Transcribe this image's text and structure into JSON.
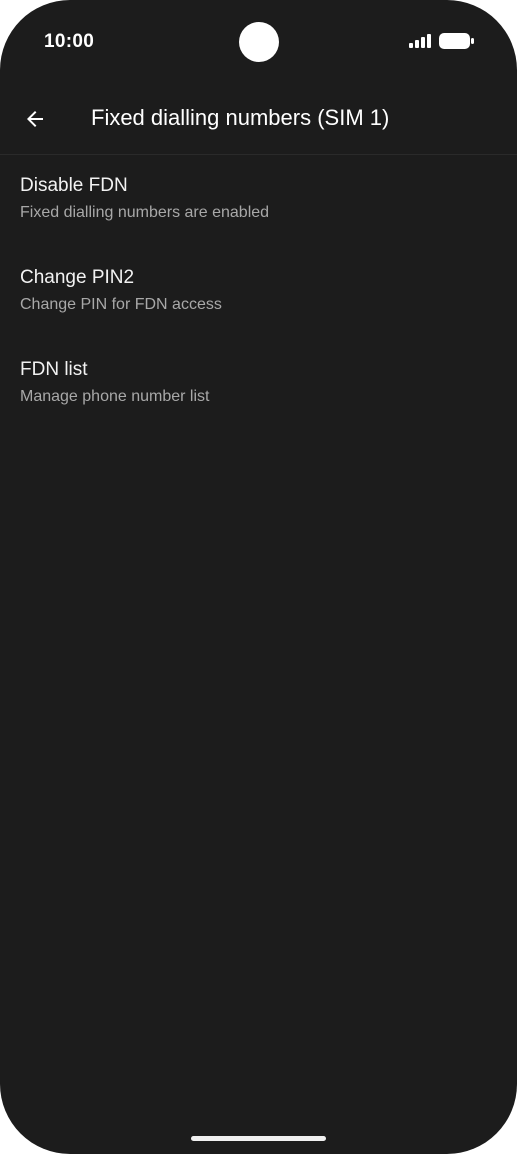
{
  "status_bar": {
    "time": "10:00",
    "signal_icon": "signal-icon",
    "battery_icon": "battery-icon"
  },
  "app_bar": {
    "back_icon": "arrow-back-icon",
    "title": "Fixed dialling numbers (SIM 1)"
  },
  "settings": {
    "items": [
      {
        "title": "Disable FDN",
        "summary": "Fixed dialling numbers are enabled"
      },
      {
        "title": "Change PIN2",
        "summary": "Change PIN for FDN access"
      },
      {
        "title": "FDN list",
        "summary": "Manage phone number list"
      }
    ]
  },
  "colors": {
    "background": "#1c1c1c",
    "title_text": "#f2f2f2",
    "summary_text": "#a8a8a8"
  }
}
